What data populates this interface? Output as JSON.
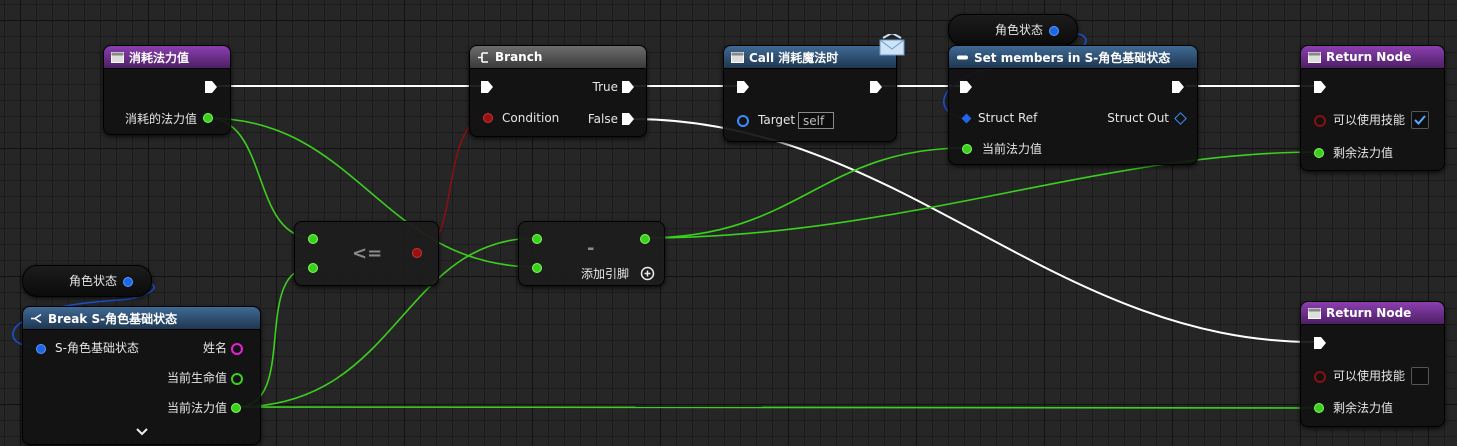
{
  "nodes": {
    "entry": {
      "title": "消耗法力值",
      "out_param": "消耗的法力值"
    },
    "branch": {
      "title": "Branch",
      "condition": "Condition",
      "true": "True",
      "false": "False"
    },
    "call": {
      "title": "Call 消耗魔法时",
      "target": "Target",
      "target_value": "self"
    },
    "set": {
      "title": "Set members in S-角色基础状态",
      "struct_ref": "Struct Ref",
      "struct_out": "Struct Out",
      "field": "当前法力值"
    },
    "return1": {
      "title": "Return Node",
      "param1": "可以使用技能",
      "param1_checked": true,
      "param2": "剩余法力值"
    },
    "return2": {
      "title": "Return Node",
      "param1": "可以使用技能",
      "param1_checked": false,
      "param2": "剩余法力值"
    },
    "var_top": {
      "label": "角色状态"
    },
    "var_left": {
      "label": "角色状态"
    },
    "break": {
      "title": "Break S-角色基础状态",
      "input": "S-角色基础状态",
      "out1": "姓名",
      "out2": "当前生命值",
      "out3": "当前法力值"
    },
    "compare": {
      "op": "<="
    },
    "subtract": {
      "op": "-",
      "add_pin": "添加引脚"
    }
  },
  "colors": {
    "float_wire": "#3ccf1e",
    "exec_wire": "#ffffff",
    "bool_wire": "#8a1010",
    "struct_wire": "#1d4fd0",
    "function_header": "#8b3fb0",
    "call_header": "#3f6a95",
    "branch_header": "#6c6c6c"
  }
}
